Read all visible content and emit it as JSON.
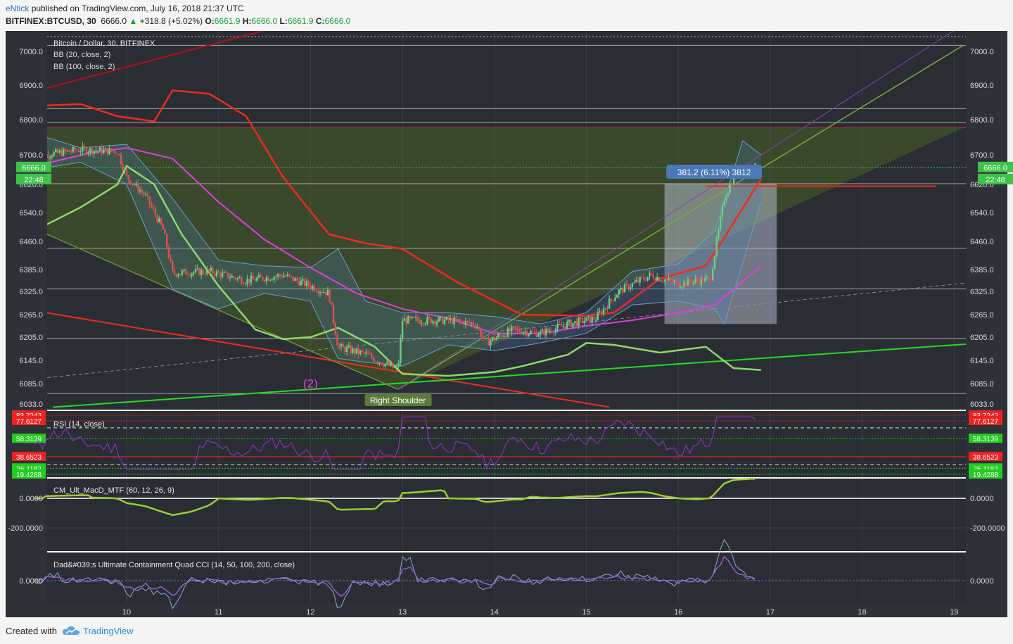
{
  "header": {
    "author": "eNtick",
    "published_text": "published on TradingView.com, July 16, 2018 21:37 UTC",
    "symbol": "BITFINEX:BTCUSD, 30",
    "last": "6666.0",
    "change": "+318.8 (+5.02%)",
    "o_label": "O:",
    "o": "6661.9",
    "h_label": "H:",
    "h": "6666.0",
    "l_label": "L:",
    "l": "6661.9",
    "c_label": "C:",
    "c": "6666.0"
  },
  "legend": {
    "title": "Bitcoin / Dollar, 30, BITFINEX",
    "bb1": "BB (20, close, 2)",
    "bb2": "BB (100, close, 2)"
  },
  "annotations": {
    "wave": "(2)",
    "shoulder": "Right Shoulder",
    "measure": "381.2 (6.11%) 3812"
  },
  "price_badges": {
    "last": "6666.0",
    "countdown": "22:48"
  },
  "panes": {
    "rsi": {
      "title": "RSI (14, close)",
      "levels": [
        "83.7242",
        "77.6127",
        "58.3139",
        "38.6523",
        "26.1182",
        "19.4288"
      ]
    },
    "macd": {
      "title": "CM_Ult_MacD_MTF (60, 12, 26, 9)",
      "ticks": [
        "0.0000",
        "-200.0000"
      ]
    },
    "cci": {
      "title": "Dad&#039;s Ultimate Containment Quad CCI (14, 50, 100, 200, close)",
      "ticks": [
        "0.0000"
      ]
    }
  },
  "footer": {
    "created": "Created with",
    "brand": "TradingView"
  },
  "colors": {
    "background": "#2a2d34",
    "up": "#6ed080",
    "down": "#e05050",
    "bb_red": "#ee2b1c",
    "bb_green": "#8ed96a",
    "magenta": "#dd40dd",
    "green_trend": "#22dd22"
  },
  "chart_data": {
    "type": "candlestick",
    "title": "Bitcoin / Dollar, 30, BITFINEX",
    "x_ticks": [
      "10",
      "11",
      "12",
      "13",
      "14",
      "15",
      "16",
      "17",
      "18",
      "19"
    ],
    "y_ticks": [
      "7000.0",
      "6900.0",
      "6800.0",
      "6700.0",
      "6620.0",
      "6540.0",
      "6460.0",
      "6385.0",
      "6325.0",
      "6265.0",
      "6205.0",
      "6145.0",
      "6085.0",
      "6033.0"
    ],
    "price_path": [
      {
        "t": 9.1,
        "p": 6700
      },
      {
        "t": 9.5,
        "p": 6715
      },
      {
        "t": 9.9,
        "p": 6710
      },
      {
        "t": 10.0,
        "p": 6640
      },
      {
        "t": 10.2,
        "p": 6590
      },
      {
        "t": 10.4,
        "p": 6490
      },
      {
        "t": 10.5,
        "p": 6375
      },
      {
        "t": 10.9,
        "p": 6380
      },
      {
        "t": 11.3,
        "p": 6355
      },
      {
        "t": 11.7,
        "p": 6370
      },
      {
        "t": 12.0,
        "p": 6340
      },
      {
        "t": 12.2,
        "p": 6320
      },
      {
        "t": 12.3,
        "p": 6180
      },
      {
        "t": 12.6,
        "p": 6160
      },
      {
        "t": 12.95,
        "p": 6120
      },
      {
        "t": 13.0,
        "p": 6250
      },
      {
        "t": 13.5,
        "p": 6250
      },
      {
        "t": 13.8,
        "p": 6240
      },
      {
        "t": 13.9,
        "p": 6190
      },
      {
        "t": 14.2,
        "p": 6225
      },
      {
        "t": 14.5,
        "p": 6215
      },
      {
        "t": 14.8,
        "p": 6240
      },
      {
        "t": 15.1,
        "p": 6255
      },
      {
        "t": 15.35,
        "p": 6325
      },
      {
        "t": 15.7,
        "p": 6370
      },
      {
        "t": 16.0,
        "p": 6345
      },
      {
        "t": 16.35,
        "p": 6360
      },
      {
        "t": 16.5,
        "p": 6580
      },
      {
        "t": 16.6,
        "p": 6640
      },
      {
        "t": 16.8,
        "p": 6666
      }
    ],
    "bb100_upper": [
      {
        "t": 9.0,
        "p": 6840
      },
      {
        "t": 9.5,
        "p": 6845
      },
      {
        "t": 9.9,
        "p": 6810
      },
      {
        "t": 10.3,
        "p": 6795
      },
      {
        "t": 10.5,
        "p": 6885
      },
      {
        "t": 10.9,
        "p": 6875
      },
      {
        "t": 11.3,
        "p": 6810
      },
      {
        "t": 11.7,
        "p": 6640
      },
      {
        "t": 12.2,
        "p": 6480
      },
      {
        "t": 12.6,
        "p": 6455
      },
      {
        "t": 13.0,
        "p": 6440
      },
      {
        "t": 13.6,
        "p": 6350
      },
      {
        "t": 14.3,
        "p": 6265
      },
      {
        "t": 15.0,
        "p": 6262
      },
      {
        "t": 15.3,
        "p": 6270
      },
      {
        "t": 15.8,
        "p": 6360
      },
      {
        "t": 16.3,
        "p": 6395
      },
      {
        "t": 16.5,
        "p": 6470
      },
      {
        "t": 16.9,
        "p": 6635
      }
    ],
    "bb100_basis": [
      {
        "t": 9.0,
        "p": 6670
      },
      {
        "t": 9.6,
        "p": 6705
      },
      {
        "t": 10.0,
        "p": 6720
      },
      {
        "t": 10.5,
        "p": 6690
      },
      {
        "t": 11.0,
        "p": 6570
      },
      {
        "t": 11.5,
        "p": 6465
      },
      {
        "t": 12.0,
        "p": 6390
      },
      {
        "t": 12.5,
        "p": 6320
      },
      {
        "t": 13.0,
        "p": 6280
      },
      {
        "t": 13.5,
        "p": 6255
      },
      {
        "t": 14.0,
        "p": 6215
      },
      {
        "t": 14.5,
        "p": 6215
      },
      {
        "t": 15.0,
        "p": 6235
      },
      {
        "t": 15.5,
        "p": 6250
      },
      {
        "t": 16.0,
        "p": 6270
      },
      {
        "t": 16.4,
        "p": 6290
      },
      {
        "t": 16.9,
        "p": 6395
      }
    ],
    "bb100_lower": [
      {
        "t": 9.0,
        "p": 6490
      },
      {
        "t": 9.5,
        "p": 6555
      },
      {
        "t": 9.9,
        "p": 6620
      },
      {
        "t": 10.0,
        "p": 6670
      },
      {
        "t": 10.3,
        "p": 6620
      },
      {
        "t": 10.6,
        "p": 6480
      },
      {
        "t": 11.0,
        "p": 6340
      },
      {
        "t": 11.4,
        "p": 6225
      },
      {
        "t": 11.7,
        "p": 6200
      },
      {
        "t": 12.0,
        "p": 6205
      },
      {
        "t": 12.3,
        "p": 6230
      },
      {
        "t": 12.7,
        "p": 6180
      },
      {
        "t": 13.0,
        "p": 6110
      },
      {
        "t": 13.5,
        "p": 6105
      },
      {
        "t": 14.0,
        "p": 6115
      },
      {
        "t": 14.3,
        "p": 6130
      },
      {
        "t": 14.8,
        "p": 6160
      },
      {
        "t": 15.0,
        "p": 6190
      },
      {
        "t": 15.3,
        "p": 6185
      },
      {
        "t": 15.8,
        "p": 6165
      },
      {
        "t": 16.3,
        "p": 6180
      },
      {
        "t": 16.6,
        "p": 6125
      },
      {
        "t": 16.9,
        "p": 6120
      }
    ],
    "bb20_upper": [
      {
        "t": 9.0,
        "p": 6760
      },
      {
        "t": 9.5,
        "p": 6720
      },
      {
        "t": 10.0,
        "p": 6730
      },
      {
        "t": 10.5,
        "p": 6580
      },
      {
        "t": 11.0,
        "p": 6410
      },
      {
        "t": 11.5,
        "p": 6395
      },
      {
        "t": 12.0,
        "p": 6390
      },
      {
        "t": 12.3,
        "p": 6440
      },
      {
        "t": 12.6,
        "p": 6300
      },
      {
        "t": 13.0,
        "p": 6270
      },
      {
        "t": 13.5,
        "p": 6270
      },
      {
        "t": 14.0,
        "p": 6260
      },
      {
        "t": 14.5,
        "p": 6240
      },
      {
        "t": 15.0,
        "p": 6270
      },
      {
        "t": 15.5,
        "p": 6380
      },
      {
        "t": 16.0,
        "p": 6400
      },
      {
        "t": 16.4,
        "p": 6490
      },
      {
        "t": 16.7,
        "p": 6740
      },
      {
        "t": 16.9,
        "p": 6700
      }
    ],
    "bb20_lower": [
      {
        "t": 9.0,
        "p": 6660
      },
      {
        "t": 9.5,
        "p": 6680
      },
      {
        "t": 10.0,
        "p": 6620
      },
      {
        "t": 10.5,
        "p": 6330
      },
      {
        "t": 11.0,
        "p": 6280
      },
      {
        "t": 11.5,
        "p": 6320
      },
      {
        "t": 12.0,
        "p": 6300
      },
      {
        "t": 12.3,
        "p": 6150
      },
      {
        "t": 12.6,
        "p": 6140
      },
      {
        "t": 13.0,
        "p": 6130
      },
      {
        "t": 13.5,
        "p": 6185
      },
      {
        "t": 14.0,
        "p": 6170
      },
      {
        "t": 14.5,
        "p": 6190
      },
      {
        "t": 15.0,
        "p": 6215
      },
      {
        "t": 15.5,
        "p": 6290
      },
      {
        "t": 16.0,
        "p": 6300
      },
      {
        "t": 16.4,
        "p": 6280
      },
      {
        "t": 16.5,
        "p": 6240
      },
      {
        "t": 16.9,
        "p": 6570
      }
    ],
    "horizontal_lines": [
      {
        "p": 7018,
        "color": "#cfcfcf"
      },
      {
        "p": 6832,
        "color": "#cfcfcf"
      },
      {
        "p": 6792,
        "color": "#cfcfcf"
      },
      {
        "p": 6777,
        "color": "#d03030"
      },
      {
        "p": 6622,
        "color": "#cfcfcf"
      },
      {
        "p": 6442,
        "color": "#cfcfcf"
      },
      {
        "p": 6332,
        "color": "#cfcfcf"
      },
      {
        "p": 6202,
        "color": "#cfcfcf"
      },
      {
        "p": 6060,
        "color": "#cfcfcf"
      }
    ],
    "trend_lines": [
      {
        "t1": 9.0,
        "p1": 6882,
        "t2": 11.5,
        "p2": 7062,
        "color": "#b01020",
        "w": 2
      },
      {
        "t1": 9.0,
        "p1": 6275,
        "t2": 15.25,
        "p2": 6025,
        "color": "#ee2b1c",
        "w": 2
      },
      {
        "t1": 9.2,
        "p1": 6025,
        "t2": 19.2,
        "p2": 6188,
        "color": "#22dd22",
        "w": 2
      },
      {
        "t1": 9.0,
        "p1": 6097,
        "t2": 19.2,
        "p2": 6350,
        "color": "#8c8c8c",
        "w": 1,
        "dash": true
      },
      {
        "t1": 12.95,
        "p1": 6070,
        "t2": 19.1,
        "p2": 7018,
        "color": "#77aa44",
        "w": 1.5
      },
      {
        "t1": 9.0,
        "p1": 6495,
        "t2": 12.95,
        "p2": 6070,
        "color": "#6a8f3a",
        "w": 1.5
      },
      {
        "t1": 12.95,
        "p1": 6070,
        "t2": 19.0,
        "p2": 7062,
        "color": "#8844aa",
        "w": 1
      }
    ],
    "measure_box": {
      "t1": 15.85,
      "t2": 17.07,
      "p_low": 6240,
      "p_high": 6622
    },
    "rsi_levels": [
      83.7242,
      77.6127,
      58.3139,
      38.6523,
      26.1182,
      19.4288
    ],
    "macd_zero": 0,
    "cci_zero": 0
  }
}
